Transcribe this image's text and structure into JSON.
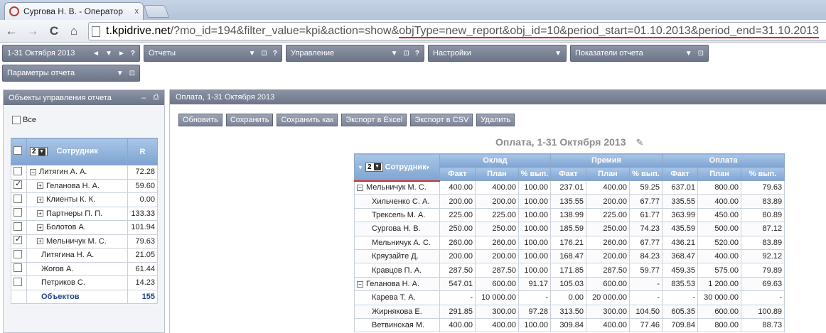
{
  "browser": {
    "tab_title": "Сургова Н. В. - Оператор",
    "tab_close": "x",
    "back": "←",
    "forward": "→",
    "reload": "C",
    "home": "⌂",
    "url_host": "t.kpidrive.net",
    "url_path": "/?mo_id=194&filter_value=kpi&action=show&",
    "url_highlight": "objType=new_report&obj_id=10&period_start=01.10.2013&period_end=31.10.2013"
  },
  "menubar": {
    "period_label": "1-31 Октября 2013",
    "reports_label": "Отчеты",
    "management_label": "Управление",
    "settings_label": "Настройки",
    "indicators_label": "Показатели отчета",
    "params_label": "Параметры отчета",
    "prev": "◄",
    "down": "▼",
    "next": "►",
    "help": "?",
    "restore": "⊡"
  },
  "left_panel": {
    "title": "Объекты управления отчета",
    "all_label": "Все",
    "level_value": "2",
    "col_employee": "Сотрудник",
    "col_r": "R",
    "rows": [
      {
        "name": "Литягин А. А.",
        "value": "72.28",
        "checked": false,
        "level": 0,
        "sign": "−"
      },
      {
        "name": "Геланова Н. А.",
        "value": "59.60",
        "checked": true,
        "level": 1,
        "sign": "+"
      },
      {
        "name": "Клиенты К. К.",
        "value": "0.00",
        "checked": false,
        "level": 1,
        "sign": "+"
      },
      {
        "name": "Партнеры П. П.",
        "value": "133.33",
        "checked": false,
        "level": 1,
        "sign": "+"
      },
      {
        "name": "Болотов А.",
        "value": "101.94",
        "checked": false,
        "level": 1,
        "sign": "+"
      },
      {
        "name": "Мельничук М. С.",
        "value": "79.63",
        "checked": true,
        "level": 1,
        "sign": "+"
      },
      {
        "name": "Литягина Н. А.",
        "value": "21.05",
        "checked": false,
        "level": 0,
        "sign": ""
      },
      {
        "name": "Жогов А.",
        "value": "61.44",
        "checked": false,
        "level": 0,
        "sign": ""
      },
      {
        "name": "Петриков С.",
        "value": "14.23",
        "checked": false,
        "level": 0,
        "sign": ""
      }
    ],
    "total_label": "Объектов",
    "total_value": "155"
  },
  "main": {
    "title": "Оплата, 1-31 Октября 2013",
    "buttons": [
      "Обновить",
      "Сохранить",
      "Сохранить как",
      "Экспорт в Excel",
      "Экспорт в CSV",
      "Удалить"
    ],
    "report_title": "Оплата, 1-31 Октября 2013",
    "pencil": "✎",
    "level_value": "2",
    "col_employee": "Сотрудник",
    "groups": [
      "Оклад",
      "Премия",
      "Оплата"
    ],
    "subcols": [
      "Факт",
      "План",
      "% вып.",
      "Факт",
      "План",
      "% вып.",
      "Факт",
      "План",
      "% вып."
    ],
    "rows": [
      {
        "name": "Мельничук М. С.",
        "parent": true,
        "cells": [
          "400.00",
          "400.00",
          "100.00",
          "237.01",
          "400.00",
          "59.25",
          "637.01",
          "800.00",
          "79.63"
        ]
      },
      {
        "name": "Хильченко С. А.",
        "parent": false,
        "cells": [
          "200.00",
          "200.00",
          "100.00",
          "135.55",
          "200.00",
          "67.77",
          "335.55",
          "400.00",
          "83.89"
        ]
      },
      {
        "name": "Трексель М. А.",
        "parent": false,
        "cells": [
          "225.00",
          "225.00",
          "100.00",
          "138.99",
          "225.00",
          "61.77",
          "363.99",
          "450.00",
          "80.89"
        ]
      },
      {
        "name": "Сургова Н. В.",
        "parent": false,
        "cells": [
          "250.00",
          "250.00",
          "100.00",
          "185.59",
          "250.00",
          "74.23",
          "435.59",
          "500.00",
          "87.12"
        ]
      },
      {
        "name": "Мельничук А. С.",
        "parent": false,
        "cells": [
          "260.00",
          "260.00",
          "100.00",
          "176.21",
          "260.00",
          "67.77",
          "436.21",
          "520.00",
          "83.89"
        ]
      },
      {
        "name": "Кряузайте Д.",
        "parent": false,
        "cells": [
          "200.00",
          "200.00",
          "100.00",
          "168.47",
          "200.00",
          "84.23",
          "368.47",
          "400.00",
          "92.12"
        ]
      },
      {
        "name": "Кравцов П. А.",
        "parent": false,
        "cells": [
          "287.50",
          "287.50",
          "100.00",
          "171.85",
          "287.50",
          "59.77",
          "459.35",
          "575.00",
          "79.89"
        ]
      },
      {
        "name": "Геланова Н. А.",
        "parent": true,
        "cells": [
          "547.01",
          "600.00",
          "91.17",
          "105.03",
          "600.00",
          "-",
          "835.53",
          "1 200.00",
          "69.63"
        ]
      },
      {
        "name": "Карева Т. А.",
        "parent": false,
        "cells": [
          "-",
          "10 000.00",
          "-",
          "0.00",
          "20 000.00",
          "-",
          "-",
          "30 000.00",
          "-"
        ]
      },
      {
        "name": "Жирнякова Е.",
        "parent": false,
        "cells": [
          "291.85",
          "300.00",
          "97.28",
          "313.50",
          "300.00",
          "104.50",
          "605.35",
          "600.00",
          "100.89"
        ]
      },
      {
        "name": "Ветвинская М.",
        "parent": false,
        "cells": [
          "400.00",
          "400.00",
          "100.00",
          "309.84",
          "400.00",
          "77.46",
          "709.84",
          "800.00",
          "88.73"
        ]
      }
    ]
  }
}
